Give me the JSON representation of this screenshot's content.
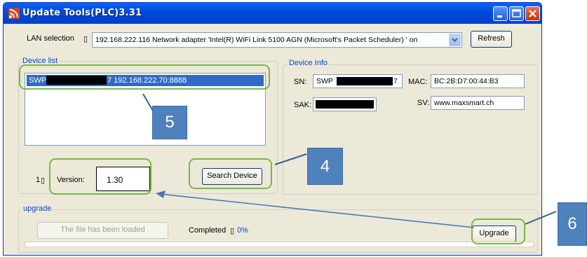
{
  "window": {
    "title": "Update Tools(PLC)3.31",
    "icon": "signal-icon"
  },
  "lan": {
    "label": "LAN selection",
    "selected": "192.168.222.116 Network adapter 'Intel(R) WiFi Link 5100 AGN (Microsoft's Packet Scheduler) ' on",
    "refresh_label": "Refresh"
  },
  "device_list": {
    "title": "Device list",
    "items": [
      {
        "prefix": "SWP",
        "suffix": "7 192.168.222.70:8888",
        "selected": true
      }
    ],
    "count": "1",
    "version_label": "Version:",
    "version_value": "1.30",
    "search_label": "Search Device"
  },
  "device_info": {
    "title": "Device Info",
    "sn_label": "SN:",
    "sn_value_prefix": "SWP",
    "sn_value_suffix": "7",
    "mac_label": "MAC:",
    "mac_value": "BC:2B:D7:00:44:B3",
    "sak_label": "SAK:",
    "sv_label": "SV:",
    "sv_value": "www.maxsmart.ch"
  },
  "upgrade": {
    "title": "upgrade",
    "file_button_label": "The file has been loaded",
    "completed_label": "Completed",
    "completed_value": "0%",
    "upgrade_label": "Upgrade",
    "progress": 0
  },
  "callouts": {
    "c4": "4",
    "c5": "5",
    "c6": "6"
  },
  "colors": {
    "highlight": "#7ab648",
    "callout": "#4f81bd",
    "titlebar": "#0a63f5",
    "selection": "#316ac5"
  }
}
